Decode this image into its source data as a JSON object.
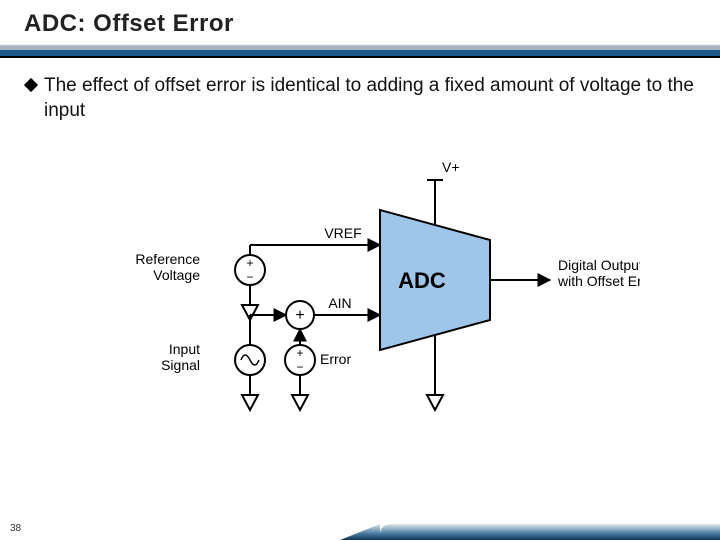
{
  "title": "ADC: Offset Error",
  "body_text": "The effect of offset error is identical to adding a fixed amount of voltage to the input",
  "page_number": "38",
  "diagram": {
    "adc_block": "ADC",
    "vref_label": "VREF",
    "vplus_label": "V+",
    "reference_voltage_label1": "Reference",
    "reference_voltage_label2": "Voltage",
    "input_signal_label1": "Input",
    "input_signal_label2": "Signal",
    "ain_label": "AIN",
    "error_label": "Error",
    "sum_plus": "+",
    "output_label1": "Digital Output",
    "output_label2": "with Offset Error",
    "plus": "+",
    "minus": "−"
  }
}
